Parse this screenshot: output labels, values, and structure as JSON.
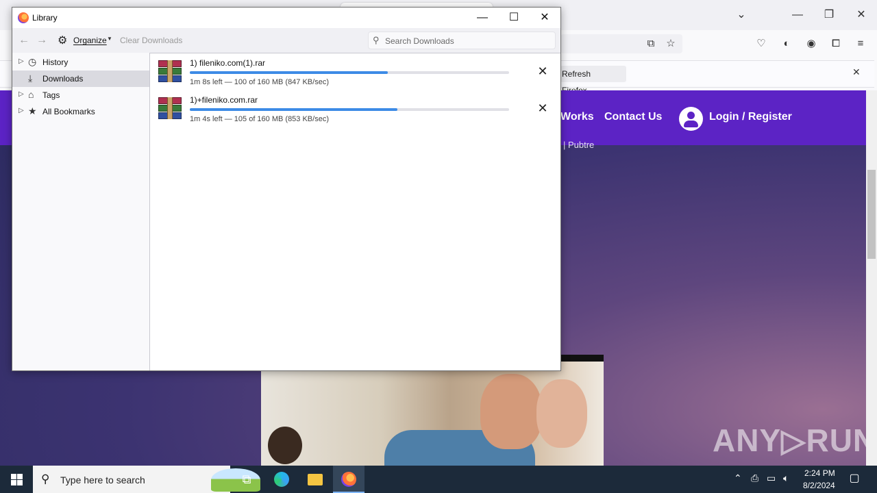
{
  "browser": {
    "refresh_button": "Refresh Firefox…",
    "nav": {
      "works": "Works",
      "contact": "Contact Us",
      "login": "Login / Register"
    },
    "faded_text": "| Pubtre",
    "watermark": "ANY▷RUN"
  },
  "library": {
    "title": "Library",
    "toolbar": {
      "organize": "Organize",
      "clear_downloads": "Clear Downloads",
      "search_placeholder": "Search Downloads"
    },
    "sidebar": [
      {
        "label": "History",
        "icon": "clock-icon",
        "selected": false,
        "expandable": true
      },
      {
        "label": "Downloads",
        "icon": "download-icon",
        "selected": true,
        "expandable": false
      },
      {
        "label": "Tags",
        "icon": "tag-icon",
        "selected": false,
        "expandable": true
      },
      {
        "label": "All Bookmarks",
        "icon": "star-icon",
        "selected": false,
        "expandable": true
      }
    ],
    "downloads": [
      {
        "name": "1) fileniko.com(1).rar",
        "status": "1m 8s left — 100 of 160 MB (847 KB/sec)",
        "progress": 0.62
      },
      {
        "name": "1)+fileniko.com.rar",
        "status": "1m 4s left — 105 of 160 MB (853 KB/sec)",
        "progress": 0.65
      }
    ]
  },
  "taskbar": {
    "search_text": "Type here to search",
    "time": "2:24 PM",
    "date": "8/2/2024"
  },
  "colors": {
    "site_header": "#5c23c5",
    "progress_fill": "#3d8be6",
    "taskbar": "#1c2a3a"
  }
}
